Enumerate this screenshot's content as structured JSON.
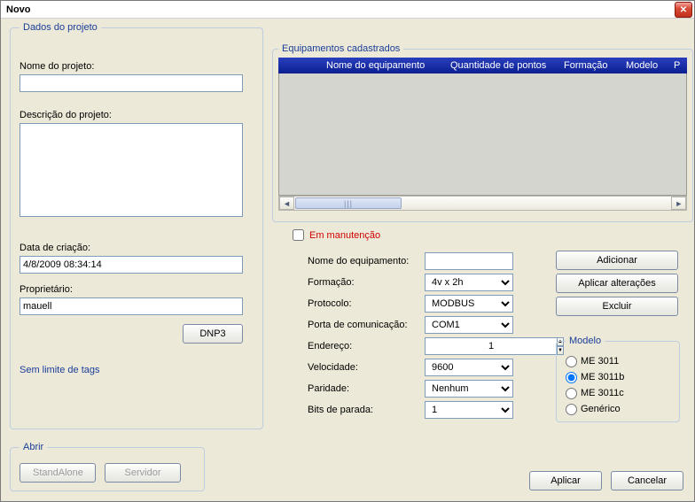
{
  "window": {
    "title": "Novo"
  },
  "project_group": {
    "legend": "Dados do projeto",
    "name_label": "Nome do projeto:",
    "name_value": "",
    "desc_label": "Descrição do projeto:",
    "desc_value": "",
    "created_label": "Data de criação:",
    "created_value": "4/8/2009 08:34:14",
    "owner_label": "Proprietário:",
    "owner_value": "mauell",
    "dnp3_btn": "DNP3",
    "tags_note": "Sem limite de tags"
  },
  "equip_group": {
    "legend": "Equipamentos cadastrados",
    "columns": {
      "blank": "",
      "name": "Nome do equipamento",
      "points": "Quantidade de pontos",
      "formation": "Formação",
      "model": "Modelo",
      "prefix": "P"
    }
  },
  "maint": {
    "checkbox_label": "Em manutenção",
    "checked": false
  },
  "equip_form": {
    "name_label": "Nome do equipamento:",
    "name_value": "",
    "formation_label": "Formação:",
    "formation_value": "4v x 2h",
    "protocol_label": "Protocolo:",
    "protocol_value": "MODBUS",
    "port_label": "Porta de comunicação:",
    "port_value": "COM1",
    "address_label": "Endereço:",
    "address_value": "1",
    "speed_label": "Velocidade:",
    "speed_value": "9600",
    "parity_label": "Paridade:",
    "parity_value": "Nenhum",
    "stopbits_label": "Bits de parada:",
    "stopbits_value": "1"
  },
  "action_buttons": {
    "add": "Adicionar",
    "apply_changes": "Aplicar alterações",
    "delete": "Excluir"
  },
  "model_group": {
    "legend": "Modelo",
    "options": {
      "me3011": "ME 3011",
      "me3011b": "ME 3011b",
      "me3011c": "ME 3011c",
      "generic": "Genérico"
    },
    "selected": "me3011b"
  },
  "open_group": {
    "legend": "Abrir",
    "standalone": "StandAlone",
    "server": "Servidor"
  },
  "footer": {
    "apply": "Aplicar",
    "cancel": "Cancelar"
  }
}
